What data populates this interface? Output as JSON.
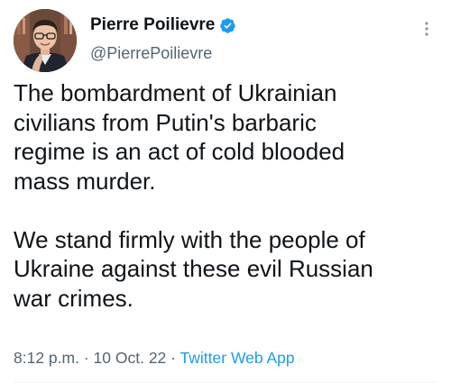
{
  "author": {
    "name": "Pierre Poilievre",
    "handle": "@PierrePoilievre",
    "verified": true
  },
  "tweet": {
    "text": "The bombardment of Ukrainian\ncivilians from Putin's barbaric\nregime is an act of cold blooded\nmass murder.\n\nWe stand firmly with the people of\nUkraine against these evil Russian\nwar crimes.",
    "time": "8:12 p.m.",
    "date": "10 Oct. 22",
    "separator": "·",
    "source": "Twitter Web App"
  },
  "colors": {
    "text": "#0f1419",
    "secondary": "#536471",
    "accent": "#1d9bf0"
  },
  "icons": {
    "verified": "verified-badge-icon",
    "more": "more-vertical-icon"
  }
}
